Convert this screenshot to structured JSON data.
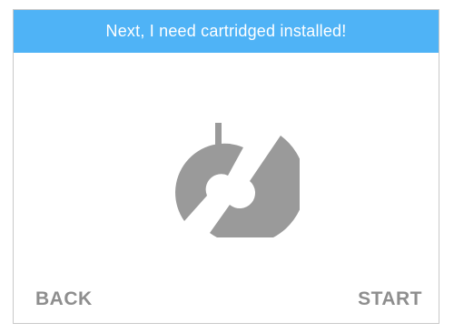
{
  "banner": {
    "title": "Next, I need cartridged installed!"
  },
  "graphic": {
    "icon": "cartridge-install-icon",
    "color": "#9a9a9a"
  },
  "actions": {
    "back_label": "BACK",
    "start_label": "START"
  },
  "colors": {
    "banner": "#4fb3f6",
    "button_text": "#8e8e8e",
    "border": "#c9c9c9"
  }
}
